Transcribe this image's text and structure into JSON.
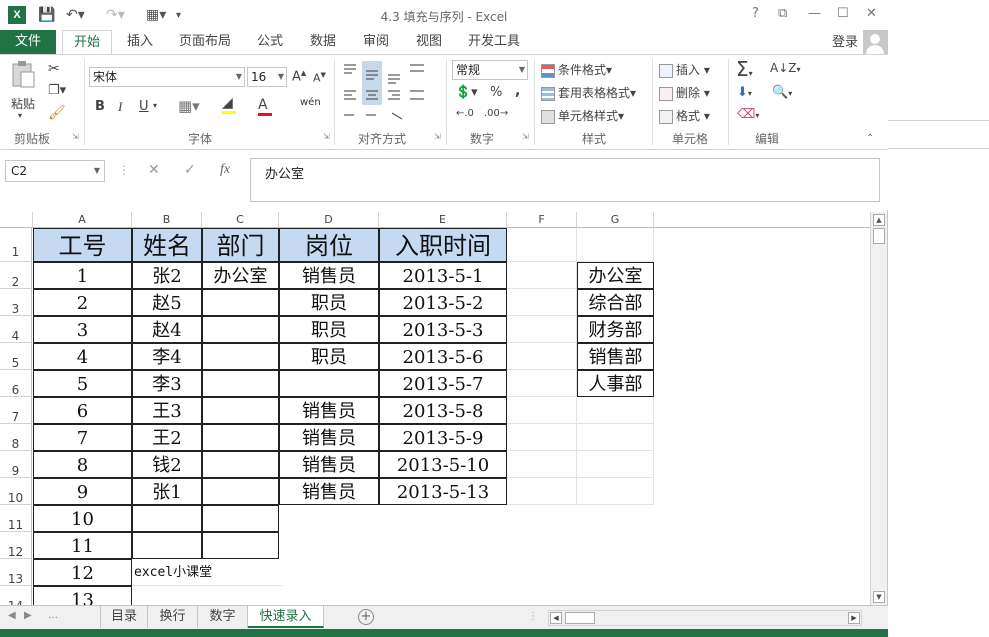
{
  "window": {
    "title": "4.3 填充与序列 - Excel",
    "help": "?",
    "restore": "⧉",
    "minimize": "—",
    "maximize": "☐",
    "close": "✕"
  },
  "ribbon_tabs": [
    "文件",
    "开始",
    "插入",
    "页面布局",
    "公式",
    "数据",
    "审阅",
    "视图",
    "开发工具"
  ],
  "login": "登录",
  "clipboard": {
    "paste": "粘贴",
    "label": "剪贴板"
  },
  "font": {
    "name": "宋体",
    "size": "16",
    "label": "字体",
    "bold": "B",
    "italic": "I",
    "underline": "U",
    "wen": "wén"
  },
  "alignment": {
    "label": "对齐方式"
  },
  "number": {
    "format": "常规",
    "label": "数字",
    "percent": "%",
    "comma": ","
  },
  "styles": {
    "conditional": "条件格式",
    "table": "套用表格格式",
    "cell": "单元格样式",
    "label": "样式"
  },
  "cells": {
    "insert": "插入",
    "delete": "删除",
    "format": "格式",
    "label": "单元格"
  },
  "editing": {
    "label": "编辑"
  },
  "formula_bar": {
    "name_box": "C2",
    "value": "办公室",
    "cancel": "✕",
    "enter": "✓",
    "fx": "fx"
  },
  "columns": [
    "A",
    "B",
    "C",
    "D",
    "E",
    "F",
    "G"
  ],
  "rows": [
    "1",
    "2",
    "3",
    "4",
    "5",
    "6",
    "7",
    "8",
    "9",
    "10",
    "11",
    "12",
    "13",
    "14"
  ],
  "sheet": {
    "header": [
      "工号",
      "姓名",
      "部门",
      "岗位",
      "入职时间"
    ],
    "data": [
      [
        "1",
        "张2",
        "办公室",
        "销售员",
        "2013-5-1"
      ],
      [
        "2",
        "赵5",
        "",
        "职员",
        "2013-5-2"
      ],
      [
        "3",
        "赵4",
        "",
        "职员",
        "2013-5-3"
      ],
      [
        "4",
        "李4",
        "",
        "职员",
        "2013-5-6"
      ],
      [
        "5",
        "李3",
        "",
        "",
        "2013-5-7"
      ],
      [
        "6",
        "王3",
        "",
        "销售员",
        "2013-5-8"
      ],
      [
        "7",
        "王2",
        "",
        "销售员",
        "2013-5-9"
      ],
      [
        "8",
        "钱2",
        "",
        "销售员",
        "2013-5-10"
      ],
      [
        "9",
        "张1",
        "",
        "销售员",
        "2013-5-13"
      ]
    ],
    "extra_ids": [
      "10",
      "11",
      "12",
      "13"
    ],
    "watermark": "excel小课堂",
    "dept_list": [
      "办公室",
      "综合部",
      "财务部",
      "销售部",
      "人事部"
    ]
  },
  "sheet_tabs": [
    "目录",
    "换行",
    "数字",
    "快速录入"
  ],
  "active_sheet": "快速录入",
  "accent_color": "#217346",
  "header_fill": "#c5d9f1"
}
